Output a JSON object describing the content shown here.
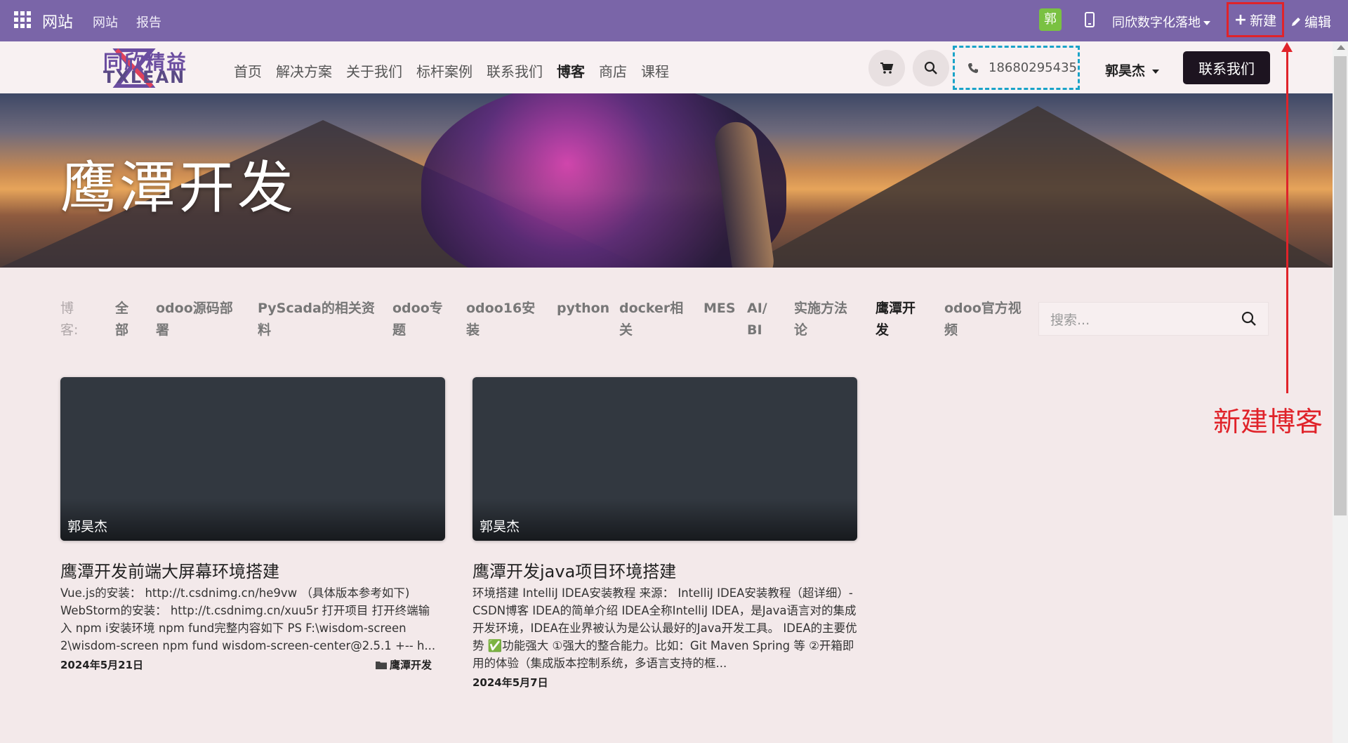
{
  "adminbar": {
    "brand": "网站",
    "links": [
      "网站",
      "报告"
    ],
    "avatar_letter": "郭",
    "site_select": "同欣数字化落地",
    "new_label": "新建",
    "edit_label": "编辑"
  },
  "header": {
    "logo_text": "同欣精益",
    "logo_subtext": "TXLEAN",
    "nav": [
      "首页",
      "解决方案",
      "关于我们",
      "标杆案例",
      "联系我们",
      "博客",
      "商店",
      "课程"
    ],
    "active_nav": "博客",
    "phone": "18680295435",
    "user": "郭昊杰",
    "contact_button": "联系我们"
  },
  "banner": {
    "title": "鹰潭开发"
  },
  "filters": {
    "label_lines": [
      "博",
      "客:"
    ],
    "items": [
      {
        "lines": [
          "全",
          "部"
        ]
      },
      {
        "lines": [
          "odoo源码部",
          "署"
        ]
      },
      {
        "lines": [
          "PyScada的相关资",
          "料"
        ]
      },
      {
        "lines": [
          "odoo专",
          "题"
        ]
      },
      {
        "lines": [
          "odoo16安",
          "装"
        ]
      },
      {
        "lines": [
          "python",
          ""
        ]
      },
      {
        "lines": [
          "docker相",
          "关"
        ]
      },
      {
        "lines": [
          "MES",
          ""
        ]
      },
      {
        "lines": [
          "AI/",
          "BI"
        ]
      },
      {
        "lines": [
          "实施方法",
          "论"
        ]
      },
      {
        "lines": [
          "鹰潭开",
          "发"
        ],
        "active": true
      },
      {
        "lines": [
          "odoo官方视",
          "频"
        ]
      }
    ],
    "search_placeholder": "搜索..."
  },
  "posts": [
    {
      "author": "郭昊杰",
      "title": "鹰潭开发前端大屏幕环境搭建",
      "excerpt": "Vue.js的安装： http://t.csdnimg.cn/he9vw （具体版本参考如下) WebStorm的安装： http://t.csdnimg.cn/xuu5r 打开项目 打开终端输入 npm i安装环境 npm fund完整内容如下 PS F:\\wisdom-screen 2\\wisdom-screen npm fund wisdom-screen-center@2.5.1 +-- h...",
      "date": "2024年5月21日",
      "tag": "鹰潭开发"
    },
    {
      "author": "郭昊杰",
      "title": "鹰潭开发java项目环境搭建",
      "excerpt": "环境搭建 IntelliJ IDEA安装教程 来源： IntelliJ IDEA安装教程（超详细）-CSDN博客 IDEA的简单介绍 IDEA全称IntelliJ IDEA，是Java语言对的集成开发环境，IDEA在业界被认为是公认最好的Java开发工具。 IDEA的主要优势 ✅功能强大 ①强大的整合能力。比如：Git Maven Spring 等 ②开箱即用的体验（集成版本控制系统，多语言支持的框...",
      "date": "2024年5月7日"
    }
  ],
  "annotation": {
    "text": "新建博客",
    "color": "#e0232a"
  },
  "colors": {
    "adminbar": "#7a65a8",
    "page_bg": "#f3e9ea",
    "card_bg": "#323840",
    "phone_border": "#1aa3c8",
    "avatar_bg": "#7ac142"
  }
}
